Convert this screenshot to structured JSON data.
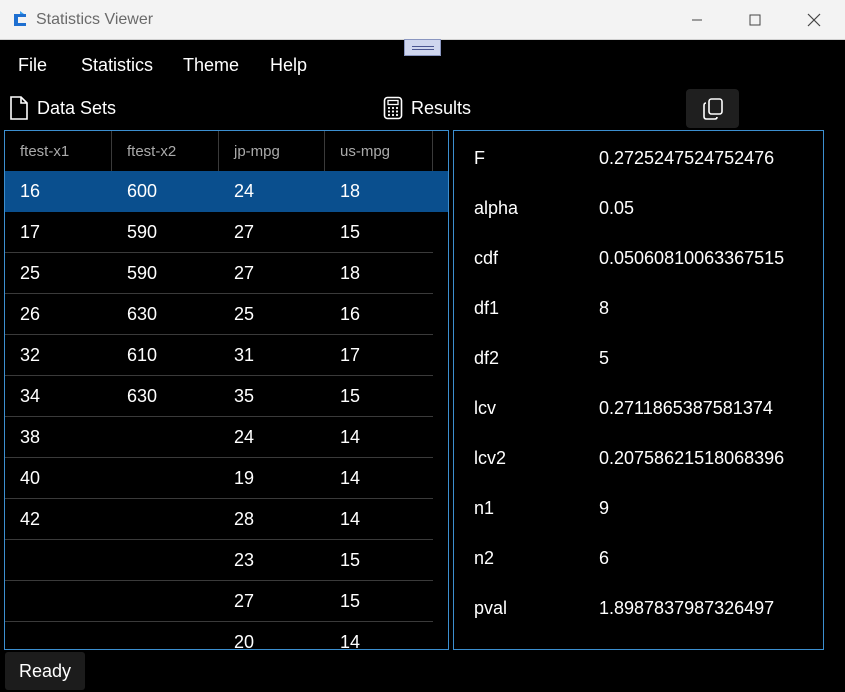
{
  "window": {
    "title": "Statistics Viewer",
    "icon": "statistics-app-icon"
  },
  "menu": {
    "items": [
      "File",
      "Statistics",
      "Theme",
      "Help"
    ]
  },
  "panels": {
    "data_sets_label": "Data Sets",
    "results_label": "Results"
  },
  "grid": {
    "columns": [
      "ftest-x1",
      "ftest-x2",
      "jp-mpg",
      "us-mpg"
    ],
    "rows": [
      [
        "16",
        "600",
        "24",
        "18"
      ],
      [
        "17",
        "590",
        "27",
        "15"
      ],
      [
        "25",
        "590",
        "27",
        "18"
      ],
      [
        "26",
        "630",
        "25",
        "16"
      ],
      [
        "32",
        "610",
        "31",
        "17"
      ],
      [
        "34",
        "630",
        "35",
        "15"
      ],
      [
        "38",
        "",
        "24",
        "14"
      ],
      [
        "40",
        "",
        "19",
        "14"
      ],
      [
        "42",
        "",
        "28",
        "14"
      ],
      [
        "",
        "",
        "23",
        "15"
      ],
      [
        "",
        "",
        "27",
        "15"
      ],
      [
        "",
        "",
        "20",
        "14"
      ]
    ],
    "selected_row": 0
  },
  "results": [
    {
      "key": "F",
      "value": "0.2725247524752476"
    },
    {
      "key": "alpha",
      "value": "0.05"
    },
    {
      "key": "cdf",
      "value": "0.05060810063367515"
    },
    {
      "key": "df1",
      "value": "8"
    },
    {
      "key": "df2",
      "value": "5"
    },
    {
      "key": "lcv",
      "value": "0.2711865387581374"
    },
    {
      "key": "lcv2",
      "value": "0.20758621518068396"
    },
    {
      "key": "n1",
      "value": "9"
    },
    {
      "key": "n2",
      "value": "6"
    },
    {
      "key": "pval",
      "value": "1.8987837987326497"
    }
  ],
  "status": {
    "text": "Ready"
  },
  "colors": {
    "accent": "#3c8fd0",
    "selection": "#0a4f8e",
    "background": "#000000"
  }
}
